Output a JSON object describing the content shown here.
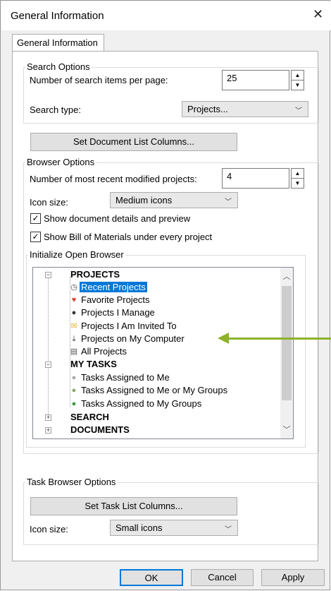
{
  "window": {
    "title": "General Information"
  },
  "tab": {
    "label": "General Information"
  },
  "search_options": {
    "legend": "Search Options",
    "items_label": "Number of search items per page:",
    "items_value": "25",
    "type_label": "Search type:",
    "type_value": "Projects..."
  },
  "doc_columns_button": "Set Document List Columns...",
  "browser_options": {
    "legend": "Browser Options",
    "recent_label": "Number of most recent modified projects:",
    "recent_value": "4",
    "icon_size_label": "Icon size:",
    "icon_size_value": "Medium icons",
    "show_details_label": "Show document details and preview",
    "show_details_checked": true,
    "show_bom_label": "Show Bill of Materials under every project",
    "show_bom_checked": true
  },
  "init_browser": {
    "legend": "Initialize Open Browser",
    "tree": {
      "projects": "PROJECTS",
      "recent_projects": "Recent Projects",
      "favorite_projects": "Favorite Projects",
      "projects_i_manage": "Projects I Manage",
      "projects_invited": "Projects I Am Invited To",
      "projects_on_computer": "Projects on My Computer",
      "all_projects": "All Projects",
      "my_tasks": "MY TASKS",
      "tasks_assigned_me": "Tasks Assigned to Me",
      "tasks_assigned_me_groups": "Tasks Assigned to Me or My Groups",
      "tasks_assigned_groups": "Tasks Assigned to My Groups",
      "search": "SEARCH",
      "documents": "DOCUMENTS"
    }
  },
  "task_browser": {
    "legend": "Task Browser Options",
    "columns_button": "Set Task List Columns...",
    "icon_size_label": "Icon size:",
    "icon_size_value": "Small icons"
  },
  "buttons": {
    "ok": "OK",
    "cancel": "Cancel",
    "apply": "Apply"
  },
  "colors": {
    "selection": "#0078d7",
    "annotation_arrow": "#8db22a"
  }
}
